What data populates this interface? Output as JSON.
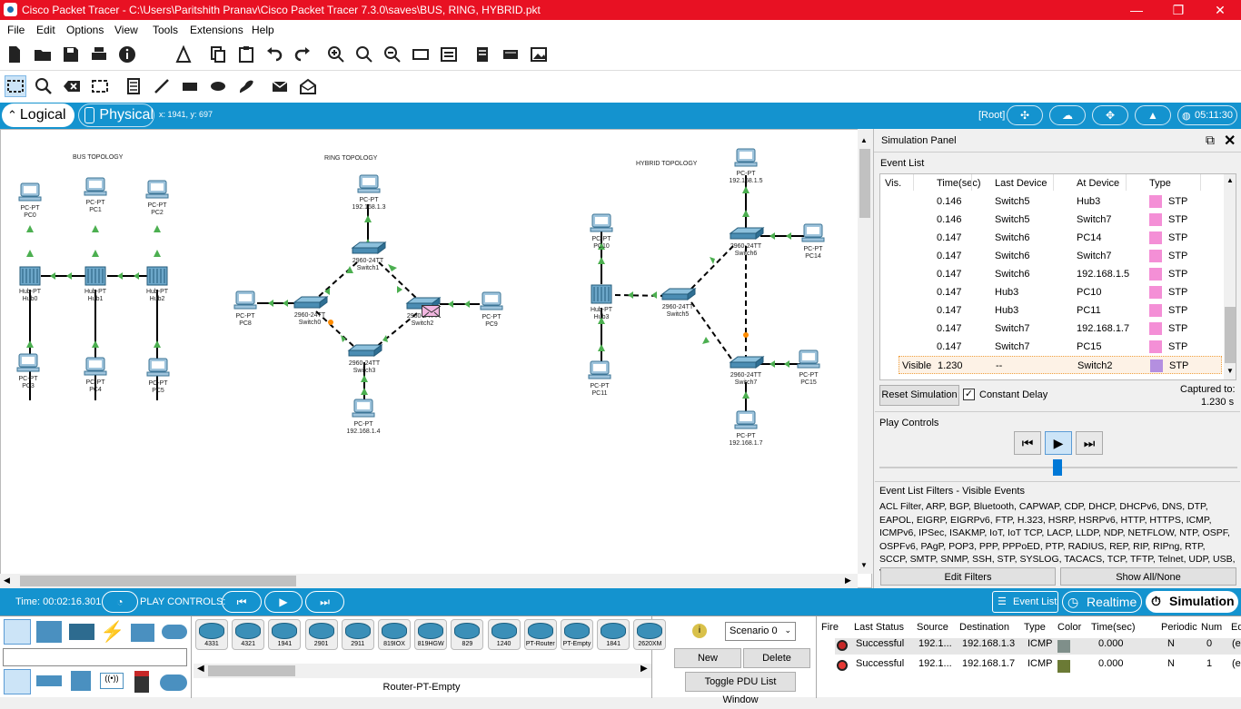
{
  "window": {
    "title": "Cisco Packet Tracer - C:\\Users\\Paritshith Pranav\\Cisco Packet Tracer 7.3.0\\saves\\BUS, RING, HYBRID.pkt",
    "min": "—",
    "max": "❐",
    "close": "✕"
  },
  "menu": [
    "File",
    "Edit",
    "Options",
    "View",
    "Tools",
    "Extensions",
    "Help"
  ],
  "help_icon": "?",
  "modes": {
    "logical": "Logical",
    "physical": "Physical",
    "coords": "x: 1941, y: 697",
    "root": "[Root]",
    "clock": "05:11:30"
  },
  "topology": {
    "bus": "BUS TOPOLOGY",
    "ring": "RING TOPOLOGY",
    "hybrid": "HYBRID TOPOLOGY",
    "devices": [
      {
        "id": "pc0",
        "l1": "PC-PT",
        "l2": "PC0"
      },
      {
        "id": "pc1",
        "l1": "PC-PT",
        "l2": "PC1"
      },
      {
        "id": "pc2",
        "l1": "PC-PT",
        "l2": "PC2"
      },
      {
        "id": "hub0",
        "l1": "Hub-PT",
        "l2": "Hub0"
      },
      {
        "id": "hub1",
        "l1": "Hub-PT",
        "l2": "Hub1"
      },
      {
        "id": "hub2",
        "l1": "Hub-PT",
        "l2": "Hub2"
      },
      {
        "id": "pc3",
        "l1": "PC-PT",
        "l2": "PC3"
      },
      {
        "id": "pc4",
        "l1": "PC-PT",
        "l2": "PC4"
      },
      {
        "id": "pc5",
        "l1": "PC-PT",
        "l2": "PC5"
      },
      {
        "id": "pctop",
        "l1": "PC-PT",
        "l2": "192.168.1.3"
      },
      {
        "id": "sw1",
        "l1": "2960-24TT",
        "l2": "Switch1"
      },
      {
        "id": "pc8",
        "l1": "PC-PT",
        "l2": "PC8"
      },
      {
        "id": "sw0",
        "l1": "2960-24TT",
        "l2": "Switch0"
      },
      {
        "id": "sw2",
        "l1": "2960-24TT",
        "l2": "Switch2"
      },
      {
        "id": "pc9",
        "l1": "PC-PT",
        "l2": "PC9"
      },
      {
        "id": "sw3",
        "l1": "2960-24TT",
        "l2": "Switch3"
      },
      {
        "id": "pcbot",
        "l1": "PC-PT",
        "l2": "192.168.1.4"
      },
      {
        "id": "pc10",
        "l1": "PC-PT",
        "l2": "PC10"
      },
      {
        "id": "hub3",
        "l1": "Hub-PT",
        "l2": "Hub3"
      },
      {
        "id": "pc11",
        "l1": "PC-PT",
        "l2": "PC11"
      },
      {
        "id": "sw5",
        "l1": "2960-24TT",
        "l2": "Switch5"
      },
      {
        "id": "pc15top",
        "l1": "PC-PT",
        "l2": "192.168.1.5"
      },
      {
        "id": "sw6",
        "l1": "2960-24TT",
        "l2": "Switch6"
      },
      {
        "id": "pc14",
        "l1": "PC-PT",
        "l2": "PC14"
      },
      {
        "id": "sw7",
        "l1": "2960-24TT",
        "l2": "Switch7"
      },
      {
        "id": "pc15",
        "l1": "PC-PT",
        "l2": "PC15"
      },
      {
        "id": "pcb2",
        "l1": "PC-PT",
        "l2": "192.168.1.7"
      }
    ]
  },
  "sim": {
    "title": "Simulation Panel",
    "event_list": "Event List",
    "headers": [
      "Vis.",
      "Time(sec)",
      "Last Device",
      "At Device",
      "Type"
    ],
    "events": [
      {
        "vis": "",
        "time": "0.146",
        "last": "Switch5",
        "at": "Hub3",
        "type": "STP"
      },
      {
        "vis": "",
        "time": "0.146",
        "last": "Switch5",
        "at": "Switch7",
        "type": "STP"
      },
      {
        "vis": "",
        "time": "0.147",
        "last": "Switch6",
        "at": "PC14",
        "type": "STP"
      },
      {
        "vis": "",
        "time": "0.147",
        "last": "Switch6",
        "at": "Switch7",
        "type": "STP"
      },
      {
        "vis": "",
        "time": "0.147",
        "last": "Switch6",
        "at": "192.168.1.5",
        "type": "STP"
      },
      {
        "vis": "",
        "time": "0.147",
        "last": "Hub3",
        "at": "PC10",
        "type": "STP"
      },
      {
        "vis": "",
        "time": "0.147",
        "last": "Hub3",
        "at": "PC11",
        "type": "STP"
      },
      {
        "vis": "",
        "time": "0.147",
        "last": "Switch7",
        "at": "192.168.1.7",
        "type": "STP"
      },
      {
        "vis": "",
        "time": "0.147",
        "last": "Switch7",
        "at": "PC15",
        "type": "STP"
      },
      {
        "vis": "Visible",
        "time": "1.230",
        "last": "--",
        "at": "Switch2",
        "type": "STP"
      }
    ],
    "reset": "Reset Simulation",
    "constant_delay": "Constant Delay",
    "captured_to": "Captured to:",
    "captured_val": "1.230 s",
    "play_controls": "Play Controls",
    "filters_title": "Event List Filters - Visible Events",
    "filters": "ACL Filter, ARP, BGP, Bluetooth, CAPWAP, CDP, DHCP, DHCPv6, DNS, DTP, EAPOL, EIGRP, EIGRPv6, FTP, H.323, HSRP, HSRPv6, HTTP, HTTPS, ICMP, ICMPv6, IPSec, ISAKMP, IoT, IoT TCP, LACP, LLDP, NDP, NETFLOW, NTP, OSPF, OSPFv6, PAgP, POP3, PPP, PPPoED, PTP, RADIUS, REP, RIP, RIPng, RTP, SCCP, SMTP, SNMP, SSH, STP, SYSLOG, TACACS, TCP, TFTP, Telnet, UDP, USB, VTP",
    "edit_filters": "Edit Filters",
    "show_all": "Show All/None"
  },
  "bottom": {
    "time": "Time: 00:02:16.301",
    "play_controls": "PLAY CONTROLS:",
    "event_list": "Event List",
    "realtime": "Realtime",
    "simulation": "Simulation",
    "devices": [
      "4331",
      "4321",
      "1941",
      "2901",
      "2911",
      "819IOX",
      "819HGW",
      "829",
      "1240",
      "PT-Router",
      "PT-Empty",
      "1841",
      "2620XM"
    ],
    "device_name": "Router-PT-Empty",
    "scenario": "Scenario 0",
    "new": "New",
    "delete": "Delete",
    "toggle": "Toggle PDU List Window",
    "pdu_headers": [
      "Fire",
      "Last Status",
      "Source",
      "Destination",
      "Type",
      "Color",
      "Time(sec)",
      "Periodic",
      "Num",
      "Ed"
    ],
    "pdus": [
      {
        "status": "Successful",
        "src": "192.1...",
        "dst": "192.168.1.3",
        "type": "ICMP",
        "color": "#7f8f8a",
        "time": "0.000",
        "periodic": "N",
        "num": "0",
        "ed": "(e"
      },
      {
        "status": "Successful",
        "src": "192.1...",
        "dst": "192.168.1.7",
        "type": "ICMP",
        "color": "#6b7a35",
        "time": "0.000",
        "periodic": "N",
        "num": "1",
        "ed": "(e"
      }
    ]
  }
}
